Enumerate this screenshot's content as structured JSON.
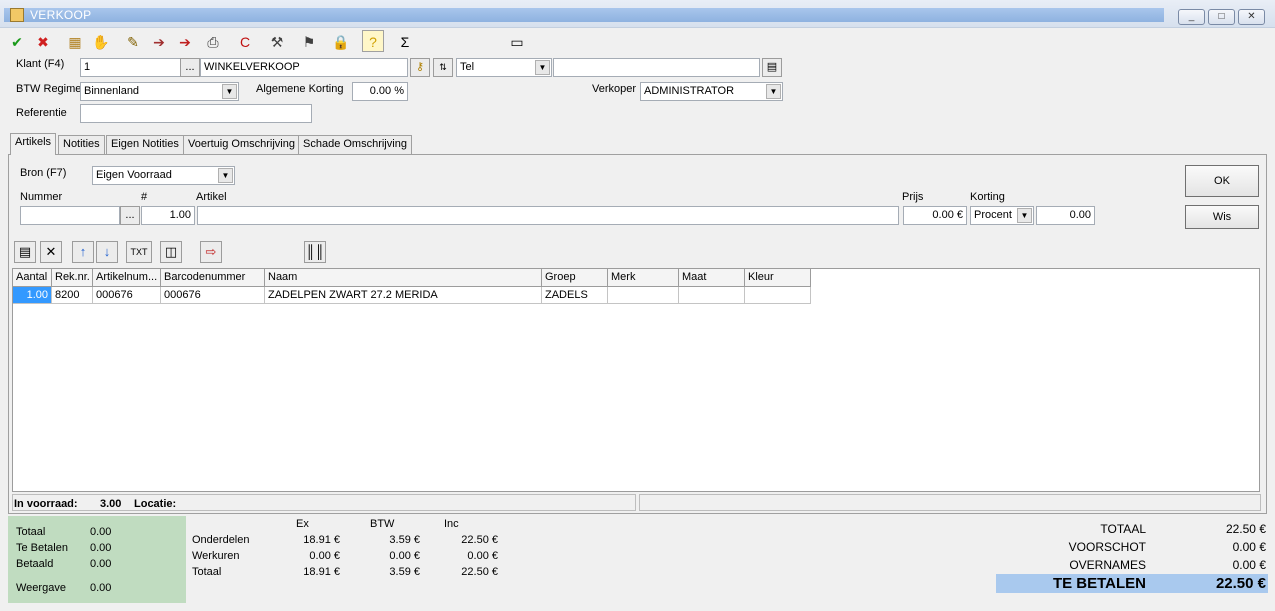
{
  "window": {
    "title": "VERKOOP",
    "controls": [
      "_",
      "□",
      "✕"
    ]
  },
  "toolbar": {
    "buttons": [
      {
        "name": "ok-check-icon",
        "glyph": "✔",
        "color": "#1a9a1a"
      },
      {
        "name": "cancel-x-icon",
        "glyph": "✖",
        "color": "#d02020"
      },
      {
        "name": "picture-icon",
        "glyph": "▦",
        "color": "#b08020"
      },
      {
        "name": "hand-icon",
        "glyph": "✋",
        "color": "#a04020"
      },
      {
        "name": "edit-icon",
        "glyph": "✎",
        "color": "#806000"
      },
      {
        "name": "export-icon",
        "glyph": "➔",
        "color": "#a03030"
      },
      {
        "name": "import-icon",
        "glyph": "➔",
        "color": "#c02020"
      },
      {
        "name": "print-icon",
        "glyph": "⎙",
        "color": "#333333"
      },
      {
        "name": "refresh-icon",
        "glyph": "C",
        "color": "#c01010"
      },
      {
        "name": "tool-icon",
        "glyph": "⚒",
        "color": "#404040"
      },
      {
        "name": "stamp-icon",
        "glyph": "⚑",
        "color": "#404040"
      },
      {
        "name": "lock-icon",
        "glyph": "🔒",
        "color": "#806020"
      },
      {
        "name": "help-icon",
        "glyph": "?",
        "color": "#d0a000"
      },
      {
        "name": "sum-icon",
        "glyph": "Σ",
        "color": "#000000"
      },
      {
        "name": "keyboard-icon",
        "glyph": "▭",
        "color": "#000000"
      }
    ]
  },
  "header": {
    "klant_label": "Klant (F4)",
    "klant_number": "1",
    "klant_name": "WINKELVERKOOP",
    "contact_type": "Tel",
    "contact_value": "",
    "btw_label": "BTW Regime",
    "btw_value": "Binnenland",
    "korting_label": "Algemene Korting",
    "korting_value": "0.00 %",
    "verkoper_label": "Verkoper",
    "verkoper_value": "ADMINISTRATOR",
    "referentie_label": "Referentie",
    "referentie_value": ""
  },
  "tabs": [
    "Artikels",
    "Notities",
    "Eigen Notities",
    "Voertuig Omschrijving",
    "Schade Omschrijving"
  ],
  "artikels": {
    "bron_label": "Bron (F7)",
    "bron_value": "Eigen Voorraad",
    "nummer_label": "Nummer",
    "hash_label": "#",
    "artikel_label": "Artikel",
    "prijs_label": "Prijs",
    "korting_label": "Korting",
    "nummer_value": "",
    "qty_value": "1.00",
    "artikel_value": "",
    "prijs_value": "0.00 €",
    "korting_type": "Procent",
    "korting_value": "0.00",
    "ok_label": "OK",
    "wis_label": "Wis",
    "ellipsis": "..."
  },
  "grid_toolbar": [
    {
      "name": "new-row-icon",
      "glyph": "▤"
    },
    {
      "name": "delete-row-icon",
      "glyph": "✕"
    },
    {
      "name": "move-up-icon",
      "glyph": "↑"
    },
    {
      "name": "move-down-icon",
      "glyph": "↓"
    },
    {
      "name": "txt-icon",
      "glyph": "TXT"
    },
    {
      "name": "columns-icon",
      "glyph": "◫"
    },
    {
      "name": "export-red-icon",
      "glyph": "⇨"
    },
    {
      "name": "barcode-icon",
      "glyph": "║║"
    }
  ],
  "grid": {
    "columns": [
      "Aantal",
      "Rek.nr.",
      "Artikelnum...",
      "Barcodenummer",
      "Naam",
      "Groep",
      "Merk",
      "Maat",
      "Kleur"
    ],
    "rows": [
      [
        "1.00",
        "8200",
        "000676",
        "000676",
        "ZADELPEN  ZWART 27.2 MERIDA",
        "ZADELS",
        "",
        "",
        ""
      ]
    ]
  },
  "status": {
    "voorraad_label": "In voorraad:",
    "voorraad_value": "3.00",
    "locatie_label": "Locatie:",
    "locatie_value": ""
  },
  "payments": [
    {
      "label": "Totaal",
      "value": "0.00"
    },
    {
      "label": "Te Betalen",
      "value": "0.00"
    },
    {
      "label": "Betaald",
      "value": "0.00"
    },
    {
      "label": "Weergave",
      "value": "0.00"
    }
  ],
  "breakdown": {
    "headers": [
      "Ex",
      "BTW",
      "Inc"
    ],
    "rows": [
      {
        "label": "Onderdelen",
        "ex": "18.91 €",
        "btw": "3.59 €",
        "inc": "22.50 €"
      },
      {
        "label": "Werkuren",
        "ex": "0.00 €",
        "btw": "0.00 €",
        "inc": "0.00 €"
      },
      {
        "label": "Totaal",
        "ex": "18.91 €",
        "btw": "3.59 €",
        "inc": "22.50 €"
      }
    ]
  },
  "totals": {
    "totaal_label": "TOTAAL",
    "totaal_value": "22.50 €",
    "voorschot_label": "VOORSCHOT",
    "voorschot_value": "0.00 €",
    "overnames_label": "OVERNAMES",
    "overnames_value": "0.00 €",
    "tebetalen_label": "TE BETALEN",
    "tebetalen_value": "22.50 €"
  },
  "colors": {
    "selection": "#3399ff",
    "payments_bg": "#c0dcc0",
    "tebetalen_bg": "#a9c9ee"
  }
}
